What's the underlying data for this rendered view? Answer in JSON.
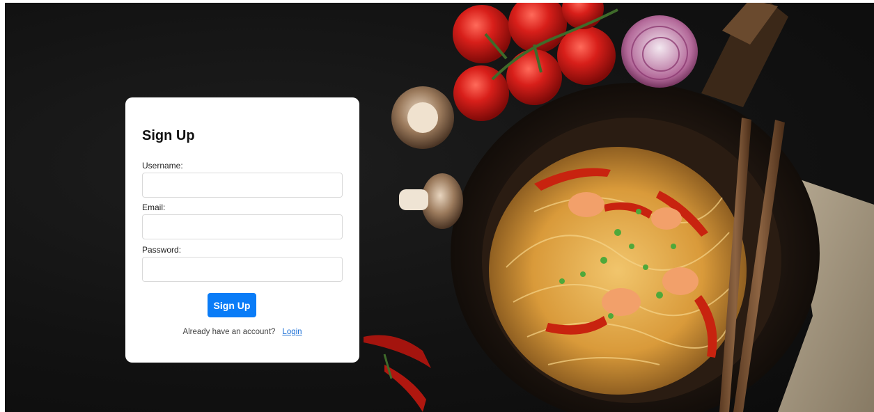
{
  "form": {
    "title": "Sign Up",
    "username_label": "Username:",
    "username_value": "",
    "email_label": "Email:",
    "email_value": "",
    "password_label": "Password:",
    "password_value": "",
    "submit_label": "Sign Up",
    "footer_text": "Already have an account?",
    "login_link": "Login"
  },
  "colors": {
    "accent": "#0a7cf7",
    "link": "#1a6fd6",
    "background": "#121212"
  }
}
